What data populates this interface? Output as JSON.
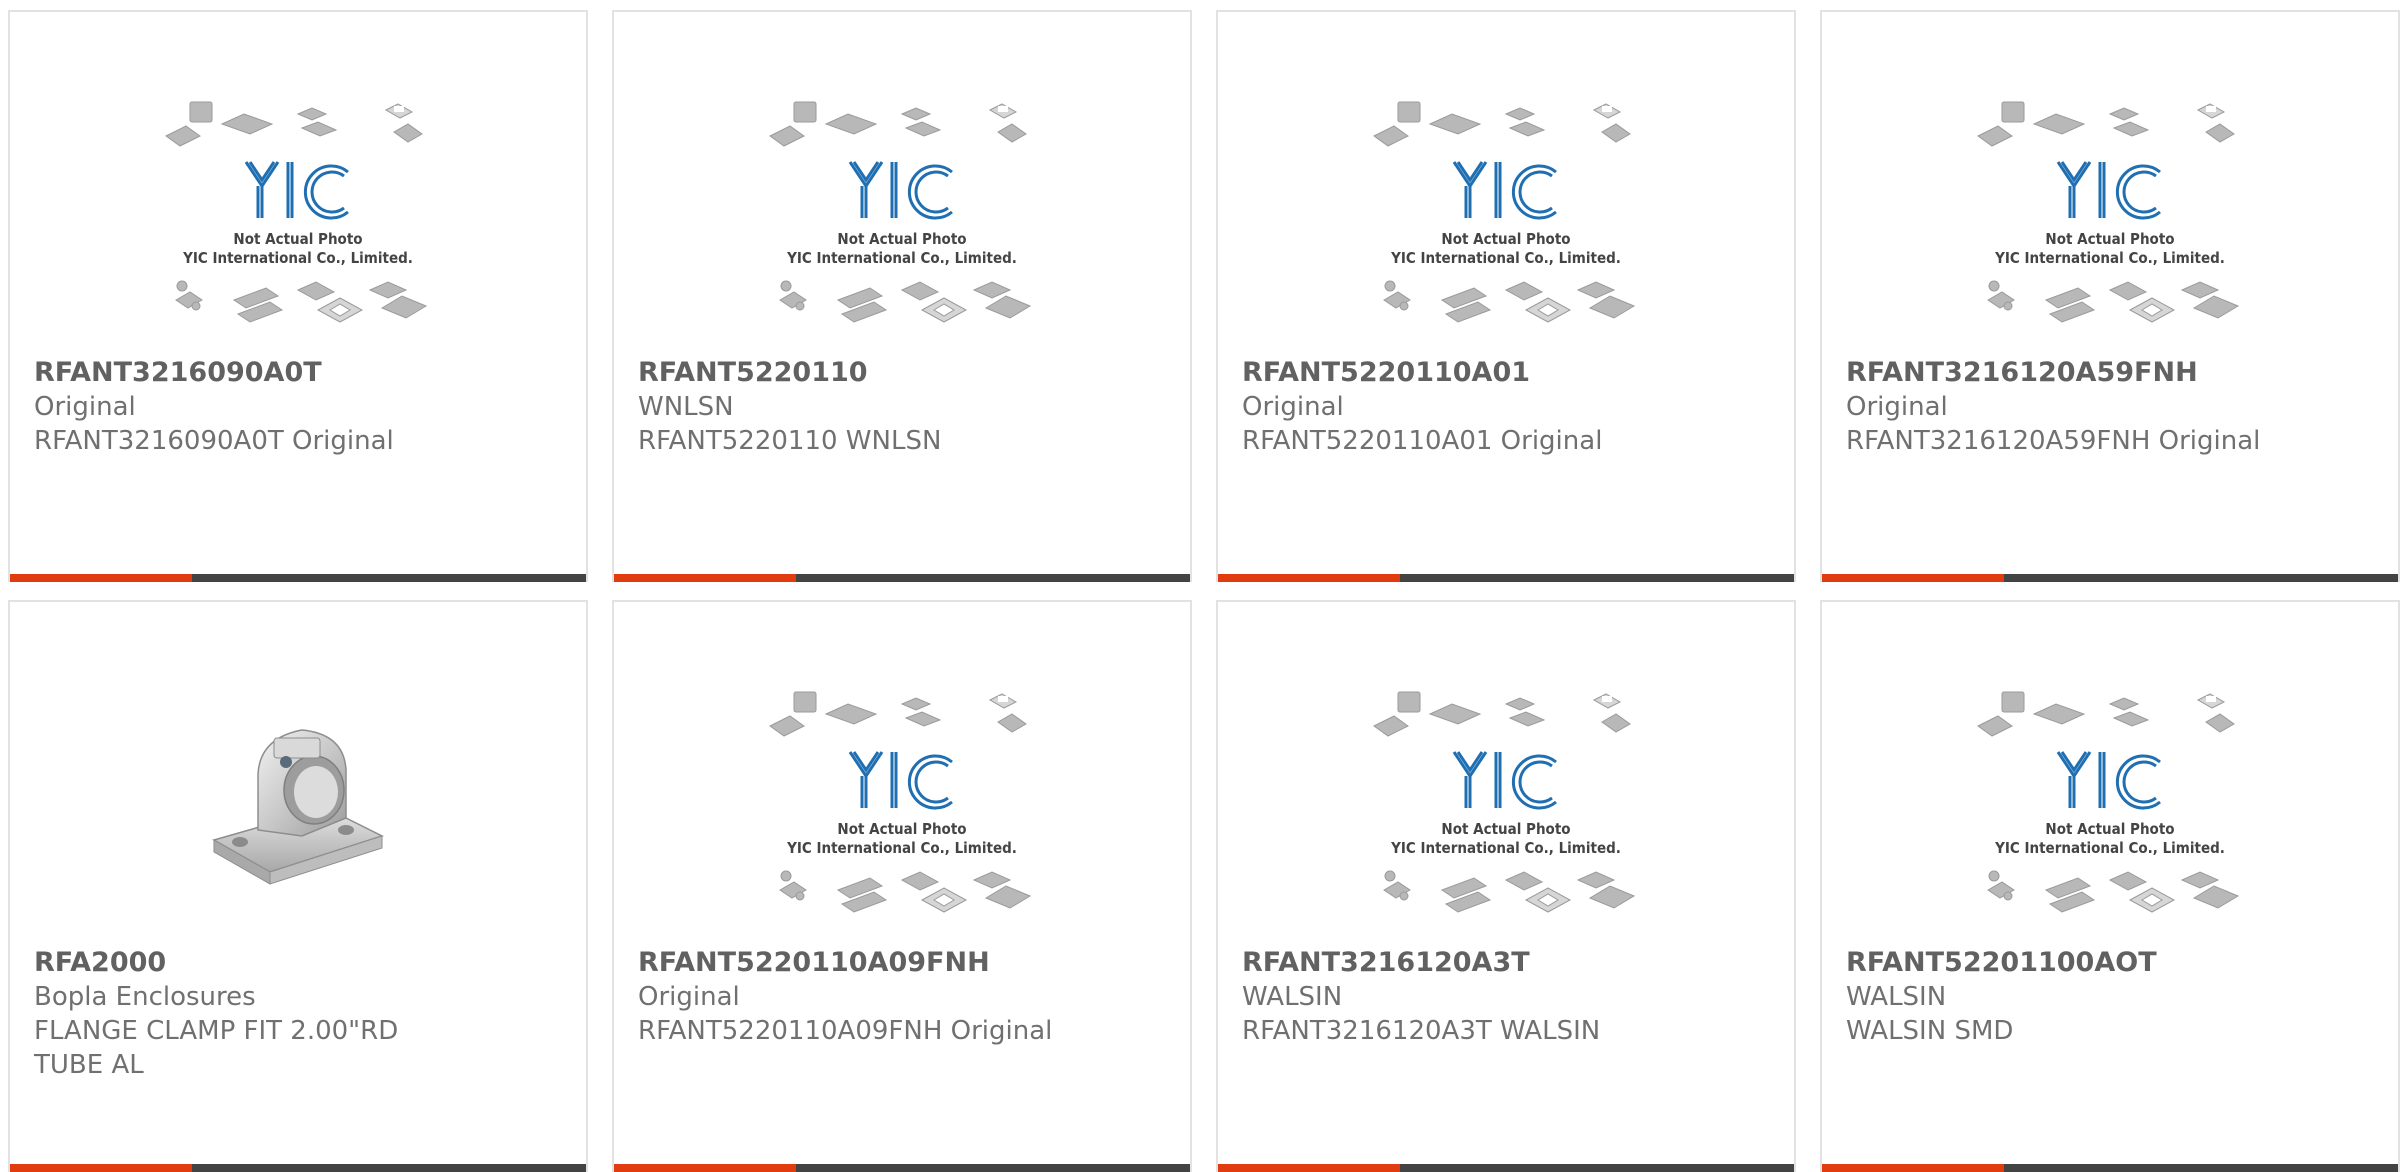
{
  "placeholder_image": {
    "line1": "Not Actual Photo",
    "line2": "YIC International Co., Limited.",
    "logo_text": "YIC"
  },
  "products": [
    {
      "part_number": "RFANT3216090A0T",
      "manufacturer": "Original",
      "description": "RFANT3216090A0T Original",
      "image": "placeholder-photo"
    },
    {
      "part_number": "RFANT5220110",
      "manufacturer": "WNLSN",
      "description": "RFANT5220110 WNLSN",
      "image": "placeholder-photo"
    },
    {
      "part_number": "RFANT5220110A01",
      "manufacturer": "Original",
      "description": "RFANT5220110A01 Original",
      "image": "placeholder-photo"
    },
    {
      "part_number": "RFANT3216120A59FNH",
      "manufacturer": "Original",
      "description": "RFANT3216120A59FNH Original",
      "image": "placeholder-photo"
    },
    {
      "part_number": "RFA2000",
      "manufacturer": "Bopla Enclosures",
      "description": "FLANGE CLAMP FIT 2.00\"RD TUBE AL",
      "image": "flange-clamp-photo"
    },
    {
      "part_number": "RFANT5220110A09FNH",
      "manufacturer": "Original",
      "description": "RFANT5220110A09FNH Original",
      "image": "placeholder-photo"
    },
    {
      "part_number": "RFANT3216120A3T",
      "manufacturer": "WALSIN",
      "description": "RFANT3216120A3T WALSIN",
      "image": "placeholder-photo"
    },
    {
      "part_number": "RFANT52201100AOT",
      "manufacturer": "WALSIN",
      "description": "WALSIN SMD",
      "image": "placeholder-photo"
    }
  ],
  "colors": {
    "accent": "#e03c0f",
    "bar": "#434343",
    "border": "#e2e2e2",
    "logo": "#1f6fb2"
  }
}
